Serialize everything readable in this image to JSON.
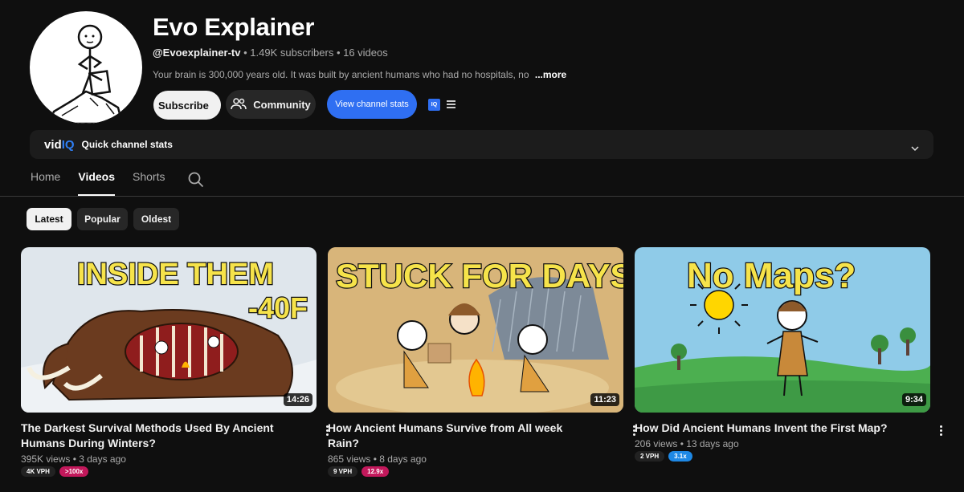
{
  "channel": {
    "name": "Evo Explainer",
    "handle": "@Evoexplainer-tv",
    "stats": " • 1.49K subscribers • 16 videos",
    "description": "Your brain is 300,000 years old. It was built by ancient humans who had no hospitals, no",
    "description_fade": " ",
    "more_label": "...more"
  },
  "actions": {
    "subscribe": "Subscribe",
    "community": "Community",
    "view_stats": "View channel stats",
    "iq_badge": "IQ"
  },
  "vidiq": {
    "logo_a": "vid",
    "logo_b": "IQ",
    "label": "Quick channel stats"
  },
  "tabs": [
    {
      "label": "Home"
    },
    {
      "label": "Videos"
    },
    {
      "label": "Shorts"
    }
  ],
  "filters": [
    {
      "label": "Latest"
    },
    {
      "label": "Popular"
    },
    {
      "label": "Oldest"
    }
  ],
  "videos": [
    {
      "thumb_text_1": "INSIDE THEM",
      "thumb_text_2": "-40F",
      "duration": "14:26",
      "title": "The Darkest Survival Methods Used By Ancient Humans During Winters?",
      "meta": "395K views • 3 days ago",
      "vph": "4K VPH",
      "multiplier": ">100x"
    },
    {
      "thumb_text_1": "STUCK FOR DAYS",
      "duration": "11:23",
      "title": "How Ancient Humans Survive from All week Rain?",
      "meta": "865 views • 8 days ago",
      "vph": "9 VPH",
      "multiplier": "12.9x"
    },
    {
      "thumb_text_1": "No Maps?",
      "duration": "9:34",
      "title": "How Did Ancient Humans Invent the First Map?",
      "meta": "206 views • 13 days ago",
      "vph": "2 VPH",
      "multiplier": "3.1x"
    }
  ],
  "colors": {
    "background": "#0f0f0f",
    "accent_blue": "#2f6ff2",
    "badge_pink": "#c2185b",
    "badge_blue": "#1e88e5"
  }
}
